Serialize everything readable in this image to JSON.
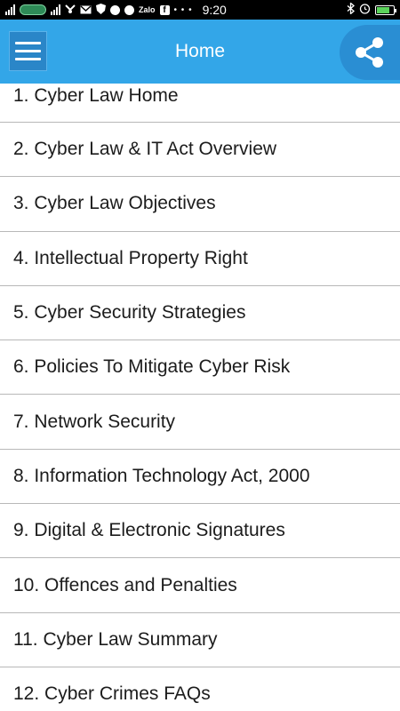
{
  "status_bar": {
    "time": "9:20",
    "notification_icons": [
      "signal-icon",
      "carrier-icon",
      "signal-icon",
      "usb-icon",
      "gmail-icon",
      "shield-icon",
      "wifi-icon",
      "notification-icon",
      "zalo-icon",
      "facebook-icon"
    ],
    "zalo_label": "Zalo",
    "facebook_label": "f",
    "overflow_dots": "• • •",
    "battery_level": 0.75,
    "battery_color": "#5bd35b"
  },
  "app_bar": {
    "title": "Home",
    "background_color": "#33a6e8",
    "menu_icon": "hamburger-menu-icon",
    "share_icon": "share-icon"
  },
  "menu": {
    "items": [
      {
        "label": "1. Cyber Law Home"
      },
      {
        "label": "2. Cyber Law & IT Act Overview"
      },
      {
        "label": "3. Cyber Law Objectives"
      },
      {
        "label": "4. Intellectual Property Right"
      },
      {
        "label": "5. Cyber Security Strategies"
      },
      {
        "label": "6. Policies To Mitigate Cyber Risk"
      },
      {
        "label": "7. Network Security"
      },
      {
        "label": "8. Information Technology Act, 2000"
      },
      {
        "label": "9. Digital & Electronic Signatures"
      },
      {
        "label": "10. Offences and Penalties"
      },
      {
        "label": "11. Cyber Law Summary"
      },
      {
        "label": "12. Cyber Crimes FAQs"
      }
    ]
  }
}
